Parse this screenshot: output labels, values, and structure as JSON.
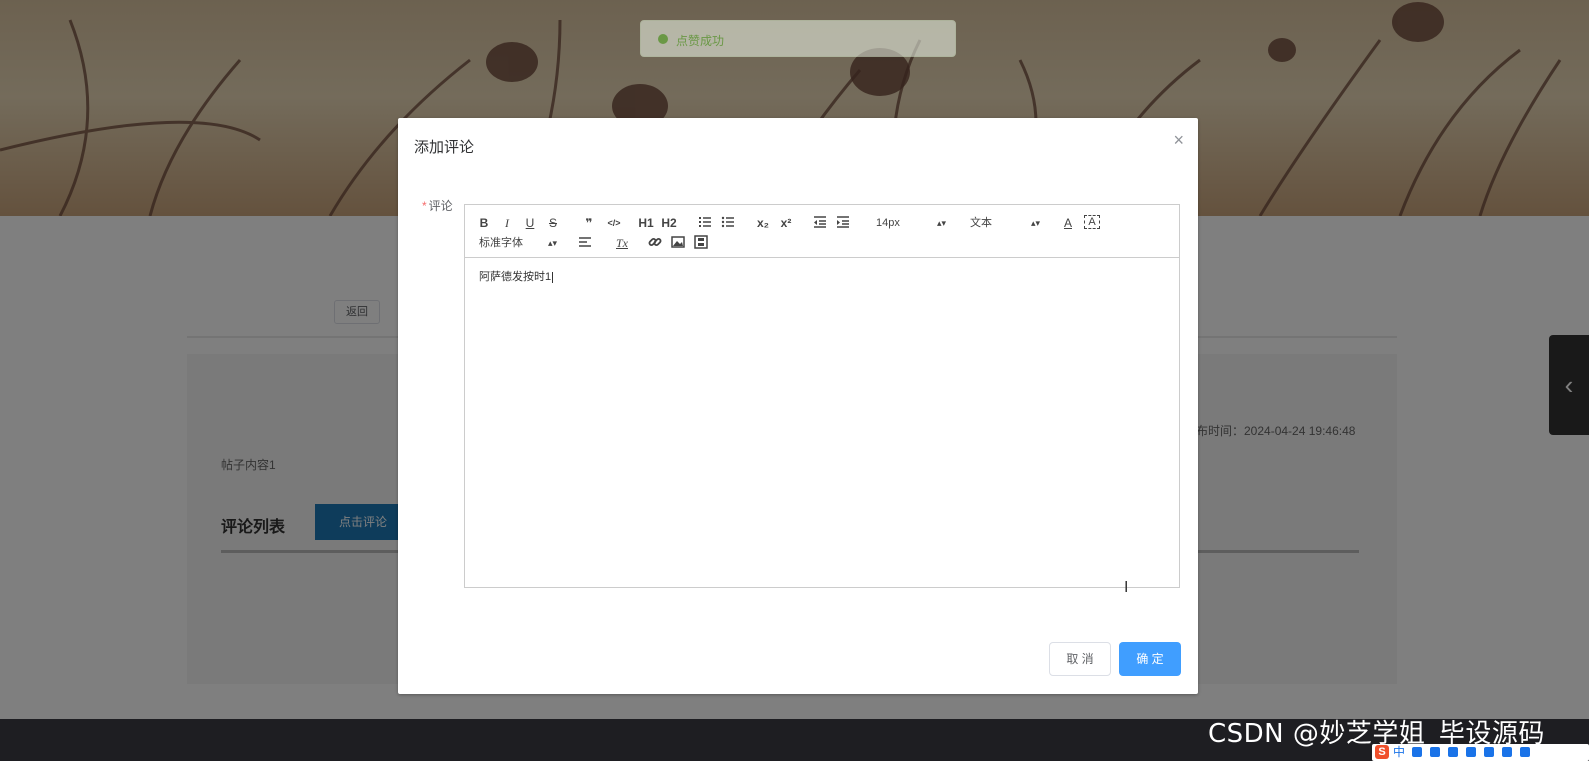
{
  "toast": {
    "message": "点赞成功"
  },
  "background": {
    "back_label": "返回",
    "post_time": "布时间：2024-04-24 19:46:48",
    "post_content": "帖子内容1",
    "comment_list_title": "评论列表",
    "comment_button_label": "点击评论",
    "side_toggle_icon": "chevron-left-icon"
  },
  "dialog": {
    "title": "添加评论",
    "close_glyph": "×",
    "field_label": "评论",
    "required_mark": "*",
    "toolbar": {
      "bold": "B",
      "italic": "I",
      "underline": "U",
      "strike": "S",
      "blockquote": "❞",
      "code": "</>",
      "h1": "H1",
      "h2": "H2",
      "ordered_list_icon": "ordered-list-icon",
      "bullet_list_icon": "bullet-list-icon",
      "subscript": "x₂",
      "superscript": "x²",
      "outdent_icon": "outdent-icon",
      "indent_icon": "indent-icon",
      "size_value": "14px",
      "header_value": "文本",
      "font_color": "A",
      "background_color": "A",
      "font_value": "标准字体",
      "align_icon": "align-left-icon",
      "clean": "Tx",
      "link_icon": "link-icon",
      "image_icon": "image-icon",
      "video_icon": "video-icon"
    },
    "editor_content": "阿萨德发按时1",
    "cancel_label": "取 消",
    "ok_label": "确 定"
  },
  "watermark": "CSDN @妙芝学姐_毕设源码",
  "ime": {
    "logo": "S",
    "lang": "中"
  },
  "colors": {
    "primary": "#409eff",
    "success": "#67c23a",
    "comment_button": "#1c79b6",
    "required": "#f56c6c"
  }
}
